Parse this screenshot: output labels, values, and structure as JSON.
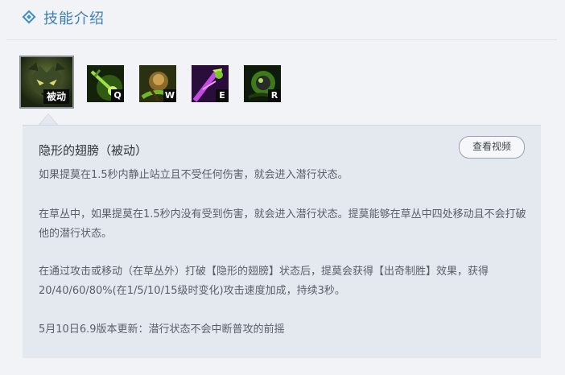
{
  "header": {
    "title": "技能介绍"
  },
  "skills": [
    {
      "key_label": "被动",
      "icon": "passive-skill-icon"
    },
    {
      "key_label": "Q",
      "icon": "q-skill-icon"
    },
    {
      "key_label": "W",
      "icon": "w-skill-icon"
    },
    {
      "key_label": "E",
      "icon": "e-skill-icon"
    },
    {
      "key_label": "R",
      "icon": "r-skill-icon"
    }
  ],
  "detail": {
    "name": "隐形的翅膀（被动）",
    "video_button": "查看视频",
    "paragraphs": [
      "如果提莫在1.5秒内静止站立且不受任何伤害，就会进入潜行状态。",
      "在草丛中，如果提莫在1.5秒内没有受到伤害，就会进入潜行状态。提莫能够在草丛中四处移动且不会打破他的潜行状态。",
      "在通过攻击或移动（在草丛外）打破【隐形的翅膀】状态后，提莫会获得【出奇制胜】效果，获得20/40/60/80%(在1/5/10/15级时变化)攻击速度加成，持续3秒。",
      "5月10日6.9版本更新：潜行状态不会中断普攻的前摇"
    ]
  }
}
